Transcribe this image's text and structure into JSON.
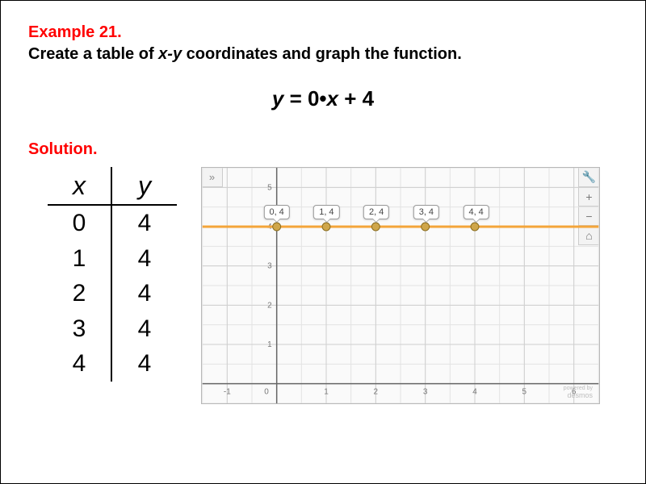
{
  "example_label": "Example 21.",
  "prompt_pre": "Create a table of ",
  "prompt_var": "x-y",
  "prompt_post": " coordinates and graph the function.",
  "equation": {
    "lhs": "y",
    "eq": " = 0•",
    "mid": "x",
    "rhs": " + 4"
  },
  "solution_label": "Solution.",
  "table": {
    "headers": {
      "x": "x",
      "y": "y"
    },
    "rows": [
      {
        "x": "0",
        "y": "4"
      },
      {
        "x": "1",
        "y": "4"
      },
      {
        "x": "2",
        "y": "4"
      },
      {
        "x": "3",
        "y": "4"
      },
      {
        "x": "4",
        "y": "4"
      }
    ]
  },
  "graph": {
    "collapse_glyph": "»",
    "controls": {
      "settings": "🔧",
      "zoom_in": "+",
      "zoom_out": "−",
      "home": "⌂"
    },
    "watermark_small": "powered by",
    "watermark": "desmos",
    "x_ticks": [
      "-1",
      "0",
      "1",
      "2",
      "3",
      "4",
      "5",
      "6"
    ],
    "y_ticks": [
      "1",
      "2",
      "3",
      "4",
      "5"
    ]
  },
  "chart_data": {
    "type": "line",
    "title": "",
    "xlabel": "",
    "ylabel": "",
    "xlim": [
      -1.5,
      6.5
    ],
    "ylim": [
      -0.5,
      5.5
    ],
    "grid": true,
    "series": [
      {
        "name": "y = 0·x + 4",
        "type": "line",
        "x": [
          -1.5,
          6.5
        ],
        "y": [
          4,
          4
        ],
        "color": "#f4a53a"
      }
    ],
    "points": [
      {
        "x": 0,
        "y": 4,
        "label": "0, 4"
      },
      {
        "x": 1,
        "y": 4,
        "label": "1, 4"
      },
      {
        "x": 2,
        "y": 4,
        "label": "2, 4"
      },
      {
        "x": 3,
        "y": 4,
        "label": "3, 4"
      },
      {
        "x": 4,
        "y": 4,
        "label": "4, 4"
      }
    ]
  }
}
